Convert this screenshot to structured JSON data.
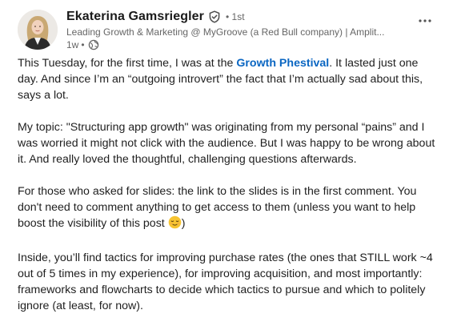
{
  "author": {
    "name": "Ekaterina Gamsriegler",
    "degree": "1st",
    "headline": "Leading Growth & Marketing @ MyGroove (a Red Bull company) | Amplit...",
    "time": "1w",
    "separator_dot": "•",
    "degree_dot": "•"
  },
  "icons": {
    "verified": "verified-badge-icon",
    "visibility": "globe-icon",
    "more": "more-options-icon",
    "emoji": "relieved-face-emoji"
  },
  "colors": {
    "link": "#0a66c2",
    "muted": "#666666",
    "text": "#1f1f1f"
  },
  "post": {
    "p1_before": "This Tuesday, for the first time, I was at the ",
    "p1_link": "Growth Phestival",
    "p1_after": ". It lasted just one day. And since I’m an “outgoing introvert” the fact that I’m actually sad about this, says a lot.",
    "p2": "My topic: \"Structuring app growth\" was originating from my personal “pains” and I was worried it might not click with the audience. But I was happy to be wrong about it. And really loved the thoughtful, challenging questions afterwards.",
    "p3_before": "For those who asked for slides: the link to the slides is in the first comment. You don't need to comment anything to get access to them (unless you want to help boost the visibility of this post ",
    "p3_after": ")",
    "p4": "Inside, you’ll find tactics for improving purchase rates (the ones that STILL work ~4 out of 5 times in my experience), for improving acquisition, and most importantly: frameworks and flowcharts to decide which tactics to pursue and which to politely ignore (at least, for now)."
  }
}
